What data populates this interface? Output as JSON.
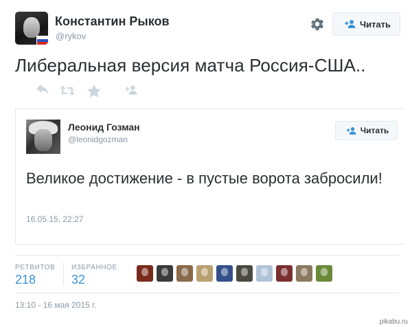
{
  "author": {
    "name": "Константин Рыков",
    "handle": "@rykov",
    "follow_label": "Читать"
  },
  "tweet": {
    "text": "Либеральная версия матча Россия-США..",
    "timestamp": "13:10 - 16 мая 2015 г."
  },
  "actions": {
    "icons": [
      "reply-icon",
      "retweet-icon",
      "favorite-icon",
      "follow-add-icon"
    ]
  },
  "quoted_tweet": {
    "name": "Леонид Гозман",
    "handle": "@leonidgozman",
    "follow_label": "Читать",
    "text": "Великое достижение - в пустые ворота забросили!",
    "date": "16.05.15, 22:27"
  },
  "stats": {
    "retweets_label": "РЕТВИТОВ",
    "retweets_count": "218",
    "favorites_label": "ИЗБРАННОЕ",
    "favorites_count": "32"
  },
  "favorited_by": {
    "colors": [
      "#7a2a1a",
      "#3a3a3a",
      "#8a6a4a",
      "#b8a070",
      "#34508a",
      "#4a4a40",
      "#b0c4d8",
      "#7a3030",
      "#8a7a60",
      "#6a8a3a"
    ]
  },
  "colors": {
    "link_blue": "#3b94d9",
    "muted_gray": "#8899a6",
    "text": "#292f33",
    "border": "#e1e8ed"
  },
  "watermark": "pikabu.ru"
}
